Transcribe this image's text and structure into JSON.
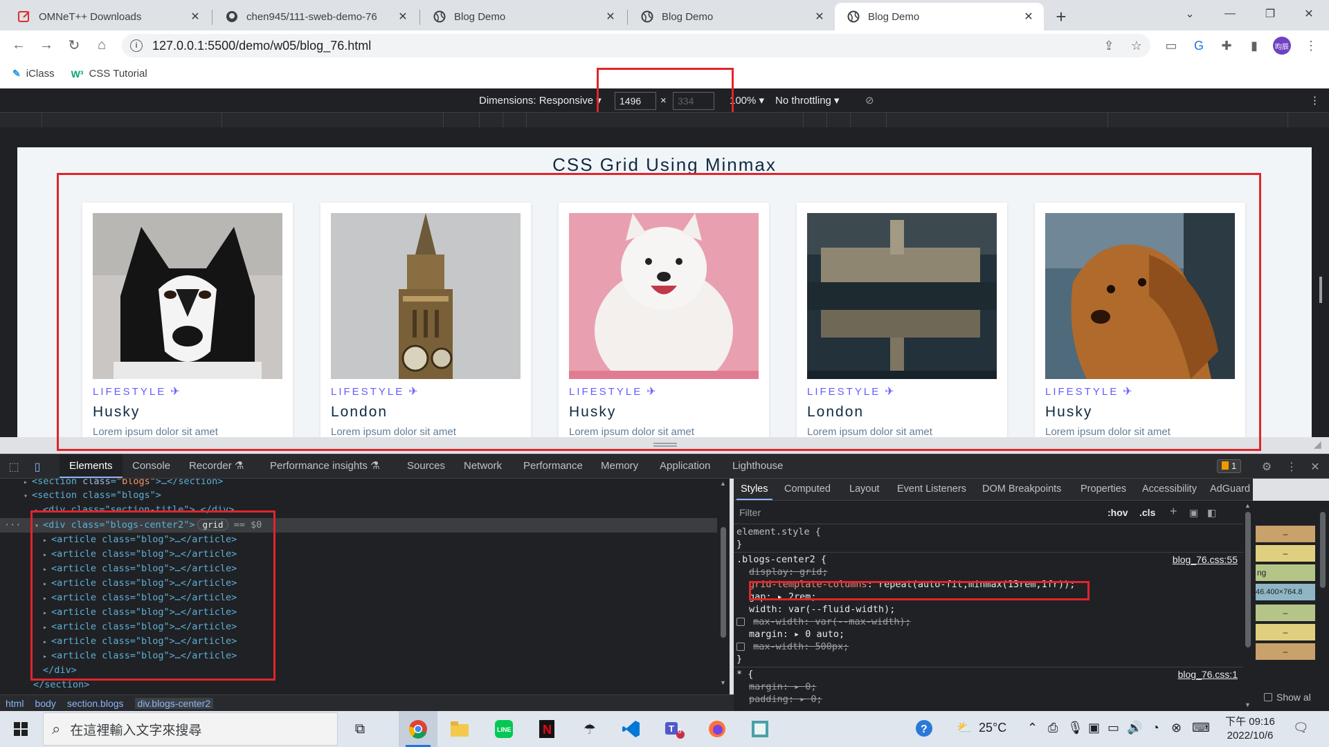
{
  "browser": {
    "tabs": [
      {
        "title": "OMNeT++ Downloads",
        "icon": "omnet-edit-icon",
        "active": false
      },
      {
        "title": "chen945/111-sweb-demo-76",
        "icon": "github-icon",
        "active": false
      },
      {
        "title": "Blog Demo",
        "icon": "globe-icon",
        "active": false
      },
      {
        "title": "Blog Demo",
        "icon": "globe-icon",
        "active": false
      },
      {
        "title": "Blog Demo",
        "icon": "globe-icon",
        "active": true
      }
    ],
    "url": "127.0.0.1:5500/demo/w05/blog_76.html",
    "profile_initials": "昀辰",
    "bookmarks": [
      {
        "label": "iClass",
        "icon": "iclass-icon"
      },
      {
        "label": "CSS Tutorial",
        "icon": "w3schools-icon"
      }
    ]
  },
  "device_toolbar": {
    "dimensions_label": "Dimensions: Responsive",
    "width_value": "1496",
    "height_placeholder": "334",
    "times": "×",
    "zoom": "100%",
    "throttling": "No throttling"
  },
  "page": {
    "title": "CSS Grid Using Minmax",
    "cards": [
      {
        "category": "LIFESTYLE",
        "title": "Husky",
        "desc": "Lorem ipsum dolor sit amet",
        "image": "husky-dog-photo"
      },
      {
        "category": "LIFESTYLE",
        "title": "London",
        "desc": "Lorem ipsum dolor sit amet",
        "image": "big-ben-photo"
      },
      {
        "category": "LIFESTYLE",
        "title": "Husky",
        "desc": "Lorem ipsum dolor sit amet",
        "image": "samoyed-dog-photo"
      },
      {
        "category": "LIFESTYLE",
        "title": "London",
        "desc": "Lorem ipsum dolor sit amet",
        "image": "london-reflection-photo"
      },
      {
        "category": "LIFESTYLE",
        "title": "Husky",
        "desc": "Lorem ipsum dolor sit amet",
        "image": "spaniel-dog-photo"
      }
    ],
    "accent_color": "#645cff"
  },
  "devtools": {
    "tabs": [
      "Elements",
      "Console",
      "Recorder",
      "Performance insights",
      "Sources",
      "Network",
      "Performance",
      "Memory",
      "Application",
      "Lighthouse"
    ],
    "issues_count": "1",
    "elements": {
      "line0": "</section>",
      "section_open": "<section class=\"blogs\">",
      "section_title": "<div class=\"section-title\">…</div>",
      "grid_div": "<div class=\"blogs-center2\">",
      "grid_badge": "grid",
      "eq0": "== $0",
      "article": "<article class=\"blog\">…</article>",
      "article_count": 9,
      "div_close": "</div>",
      "section_close": "</section>"
    },
    "breadcrumbs": [
      "html",
      "body",
      "section.blogs",
      "div.blogs-center2"
    ],
    "styles_tabs": [
      "Styles",
      "Computed",
      "Layout",
      "Event Listeners",
      "DOM Breakpoints",
      "Properties",
      "Accessibility",
      "AdGuard"
    ],
    "filter_placeholder": "Filter",
    "hov": ":hov",
    "cls": ".cls",
    "styles": {
      "element_style": "element.style {",
      "close_brace": "}",
      "rule_selector": ".blogs-center2 {",
      "rule_source": "blog_76.css:55",
      "display": "display: grid;",
      "gtc_prop": "grid-template-columns",
      "gtc_value": "repeat(auto-fit,minmax(13rem,1fr));",
      "gap": "gap: ▸ 2rem;",
      "width": "width: var(--fluid-width);",
      "max_width1": "max-width: var(--max-width);",
      "margin": "margin: ▸ 0 auto;",
      "max_width2": "max-width: 500px;",
      "star_selector": "* {",
      "star_source": "blog_76.css:1",
      "star_margin": "margin: ▸ 0;",
      "star_padding": "padding: ▸ 0;"
    },
    "boxmodel": {
      "dash": "–",
      "ng": "ng",
      "size": "46.400×764.8"
    },
    "show_all": "Show al"
  },
  "taskbar": {
    "search_placeholder": "在這裡輸入文字來搜尋",
    "weather": "25°C",
    "time": "下午 09:16",
    "date": "2022/10/6",
    "teams_badge": "6"
  }
}
